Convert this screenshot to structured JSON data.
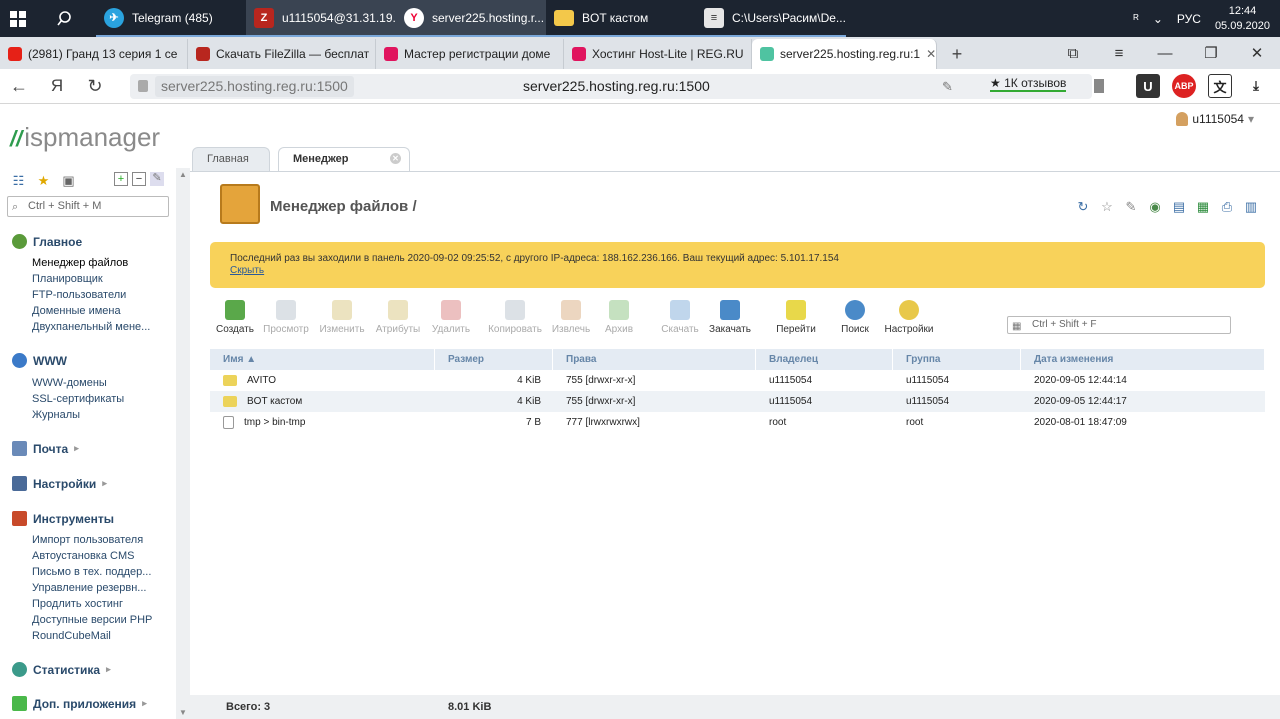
{
  "taskbar": {
    "apps": [
      {
        "label": "Telegram (485)",
        "icon": "telegram-icon",
        "badge": "485",
        "color": "#2aa3df"
      },
      {
        "label": "u1115054@31.31.19...",
        "icon": "filezilla-icon",
        "color": "#b8261e"
      },
      {
        "label": "server225.hosting.r...",
        "icon": "yandex-browser-icon",
        "color": "#ffffff"
      },
      {
        "label": "BOT кастом",
        "icon": "folder-icon",
        "color": "#f3c84a"
      },
      {
        "label": "C:\\Users\\Расим\\De...",
        "icon": "notepad-icon",
        "color": "#e6e6e6"
      }
    ],
    "lang": "РУС",
    "time": "12:44",
    "date": "05.09.2020"
  },
  "browser": {
    "tabs": [
      {
        "label": "(2981) Гранд 13 серия 1 се",
        "color": "#e62117"
      },
      {
        "label": "Скачать FileZilla — бесплат",
        "color": "#b8261e"
      },
      {
        "label": "Мастер регистрации доме",
        "color": "#e0145e"
      },
      {
        "label": "Хостинг Host-Lite | REG.RU",
        "color": "#e0145e"
      },
      {
        "label": "server225.hosting.reg.ru:1",
        "color": "#4fc3a1",
        "active": true
      }
    ],
    "address_chip": "server225.hosting.reg.ru:1500",
    "address_center": "server225.hosting.reg.ru:1500",
    "reviews": "★ 1К отзывов",
    "yandex_letter": "Я"
  },
  "isp": {
    "logo_text": "ispmanager",
    "user": "u1115054",
    "sidebar": {
      "search_placeholder": "Ctrl + Shift + M",
      "sections": [
        {
          "title": "Главное",
          "items": [
            "Менеджер файлов",
            "Планировщик",
            "FTP-пользователи",
            "Доменные имена",
            "Двухпанельный мене..."
          ]
        },
        {
          "title": "WWW",
          "items": [
            "WWW-домены",
            "SSL-сертификаты",
            "Журналы"
          ]
        },
        {
          "title": "Почта",
          "items": []
        },
        {
          "title": "Настройки",
          "items": []
        },
        {
          "title": "Инструменты",
          "items": [
            "Импорт пользователя",
            "Автоустановка CMS",
            "Письмо в тех. поддер...",
            "Управление резервн...",
            "Продлить хостинг",
            "Доступные версии PHP",
            "RoundCubeMail"
          ]
        },
        {
          "title": "Статистика",
          "items": []
        },
        {
          "title": "Доп. приложения",
          "items": []
        }
      ]
    },
    "tabs": [
      "Главная",
      "Менеджер файлов"
    ],
    "page_title": "Менеджер файлов /",
    "notice": "Последний раз вы заходили в панель 2020-09-02 09:25:52, с другого IP-адреса: 188.162.236.166. Ваш текущий адрес: 5.101.17.154",
    "notice_hide": "Скрыть",
    "toolbar": [
      {
        "label": "Создать",
        "enabled": true,
        "color": "#5aa84a"
      },
      {
        "label": "Просмотр",
        "enabled": false,
        "color": "#9aa8b8"
      },
      {
        "label": "Изменить",
        "enabled": false,
        "color": "#c8b04a"
      },
      {
        "label": "Атрибуты",
        "enabled": false,
        "color": "#c8b04a"
      },
      {
        "label": "Удалить",
        "enabled": false,
        "color": "#c84a4a"
      },
      {
        "label": "Копировать",
        "enabled": false,
        "color": "#9aa8b8"
      },
      {
        "label": "Извлечь",
        "enabled": false,
        "color": "#c88a4a"
      },
      {
        "label": "Архив",
        "enabled": false,
        "color": "#5aa84a"
      },
      {
        "label": "Скачать",
        "enabled": false,
        "color": "#4a8ac8"
      },
      {
        "label": "Закачать",
        "enabled": true,
        "color": "#4a8ac8"
      },
      {
        "label": "Перейти",
        "enabled": true,
        "color": "#e8d84a"
      },
      {
        "label": "Поиск",
        "enabled": true,
        "color": "#4a8ac8"
      },
      {
        "label": "Настройки",
        "enabled": true,
        "color": "#e8c84a"
      }
    ],
    "filter_placeholder": "Ctrl + Shift + F",
    "columns": [
      "Имя ▲",
      "Размер",
      "Права",
      "Владелец",
      "Группа",
      "Дата изменения"
    ],
    "rows": [
      {
        "name": "AVITO",
        "type": "folder",
        "size": "4 KiB",
        "perm": "755 [drwxr-xr-x]",
        "owner": "u1115054",
        "group": "u1115054",
        "date": "2020-09-05 12:44:14"
      },
      {
        "name": "BOT кастом",
        "type": "folder",
        "size": "4 KiB",
        "perm": "755 [drwxr-xr-x]",
        "owner": "u1115054",
        "group": "u1115054",
        "date": "2020-09-05 12:44:17"
      },
      {
        "name": "tmp > bin-tmp",
        "type": "link",
        "size": "7 B",
        "perm": "777 [lrwxrwxrwx]",
        "owner": "root",
        "group": "root",
        "date": "2020-08-01 18:47:09"
      }
    ],
    "footer_total": "Всего: 3",
    "footer_size": "8.01 KiB"
  }
}
